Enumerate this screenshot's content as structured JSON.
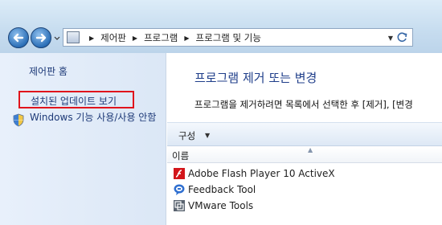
{
  "address_bar": {
    "breadcrumbs": [
      "제어판",
      "프로그램",
      "프로그램 및 기능"
    ]
  },
  "left_pane": {
    "home_link": "제어판 홈",
    "installed_updates_link": "설치된 업데이트 보기",
    "windows_features_link": "Windows 기능 사용/사용 안함"
  },
  "main": {
    "title": "프로그램 제거 또는 변경",
    "description": "프로그램을 제거하려면 목록에서 선택한 후 [제거], [변경",
    "toolbar": {
      "organize_label": "구성"
    },
    "columns": {
      "name": "이름"
    },
    "programs": [
      {
        "name": "Adobe Flash Player 10 ActiveX",
        "icon": "flash-icon"
      },
      {
        "name": "Feedback Tool",
        "icon": "feedback-tool-icon"
      },
      {
        "name": "VMware Tools",
        "icon": "vmware-icon"
      }
    ]
  },
  "colors": {
    "highlight_box": "#e0141c",
    "link": "#1e3a78",
    "title": "#1f3e8a"
  }
}
